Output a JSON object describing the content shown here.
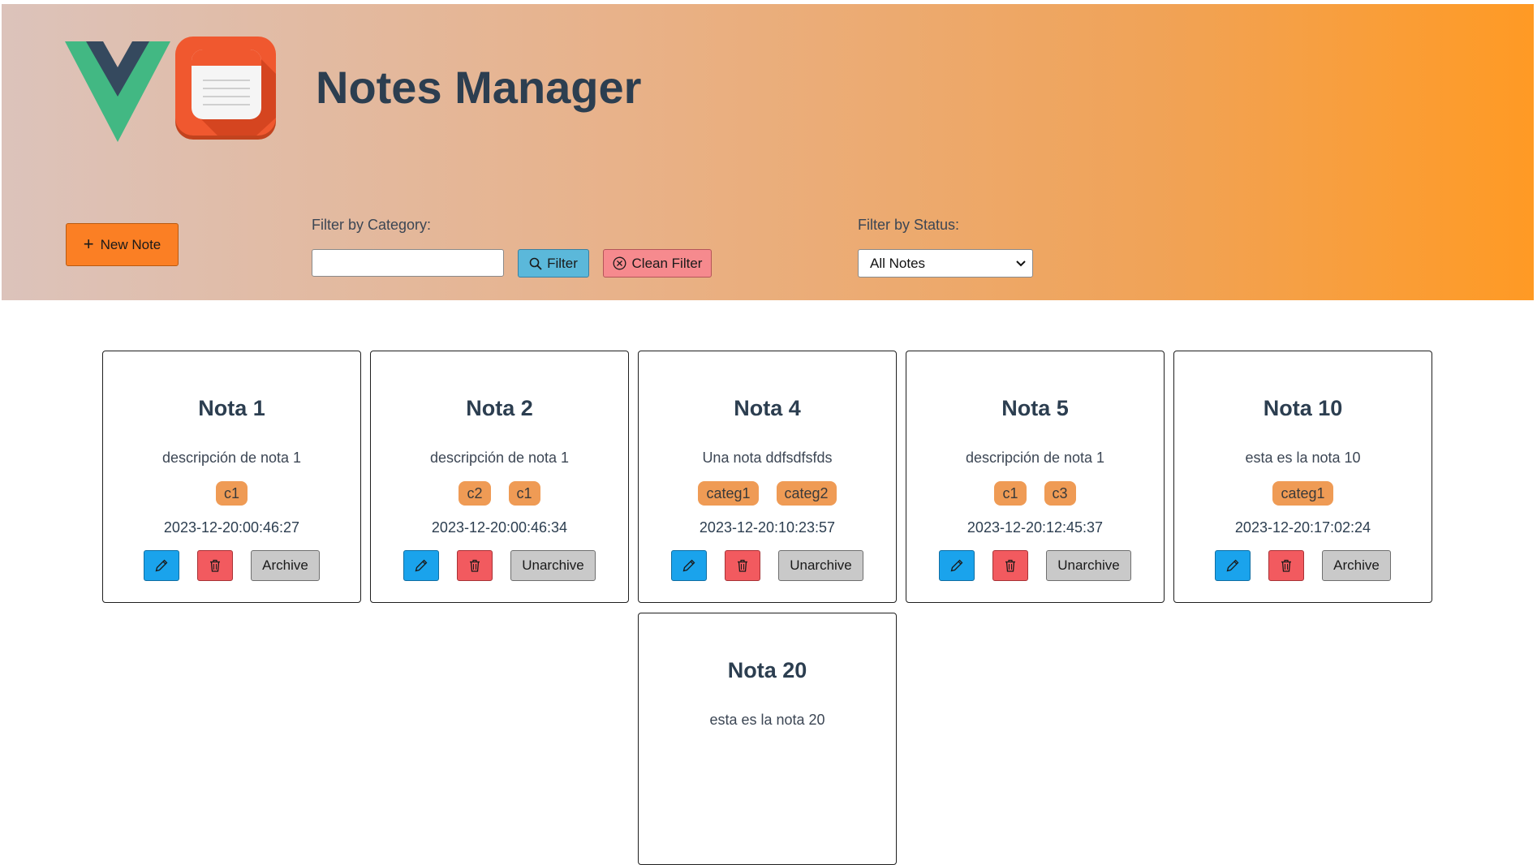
{
  "header": {
    "title": "Notes Manager",
    "new_note_label": "New Note",
    "filter_category_label": "Filter by Category:",
    "category_input_value": "",
    "filter_button_label": "Filter",
    "clean_filter_label": "Clean Filter",
    "filter_status_label": "Filter by Status:",
    "status_selected": "All Notes"
  },
  "colors": {
    "header_gradient_start": "#dcc3bb",
    "header_gradient_end": "#ff9a24",
    "new_note_button": "#fb7f24",
    "filter_button": "#5bb8da",
    "clean_filter_button": "#f68a8e",
    "tag": "#ef9b55",
    "edit_button": "#1aa3ec",
    "delete_button": "#f25a5f",
    "archive_button": "#c9c9c9"
  },
  "icons": {
    "vue": "vue-logo",
    "app": "notepad-logo",
    "new_note": "plus-icon",
    "filter": "search-icon",
    "clean": "circle-x-icon",
    "status": "chevron-down-icon",
    "edit": "pencil-icon",
    "delete": "trash-icon"
  },
  "notes": [
    {
      "title": "Nota 1",
      "description": "descripción de nota 1",
      "tags": [
        "c1"
      ],
      "date": "2023-12-20:00:46:27",
      "archive_label": "Archive"
    },
    {
      "title": "Nota 2",
      "description": "descripción de nota 1",
      "tags": [
        "c2",
        "c1"
      ],
      "date": "2023-12-20:00:46:34",
      "archive_label": "Unarchive"
    },
    {
      "title": "Nota 4",
      "description": "Una nota ddfsdfsfds",
      "tags": [
        "categ1",
        "categ2"
      ],
      "date": "2023-12-20:10:23:57",
      "archive_label": "Unarchive"
    },
    {
      "title": "Nota 5",
      "description": "descripción de nota 1",
      "tags": [
        "c1",
        "c3"
      ],
      "date": "2023-12-20:12:45:37",
      "archive_label": "Unarchive"
    },
    {
      "title": "Nota 10",
      "description": "esta es la nota 10",
      "tags": [
        "categ1"
      ],
      "date": "2023-12-20:17:02:24",
      "archive_label": "Archive"
    },
    {
      "title": "Nota 20",
      "description": "esta es la nota 20",
      "tags": [],
      "date": "",
      "archive_label": ""
    }
  ]
}
